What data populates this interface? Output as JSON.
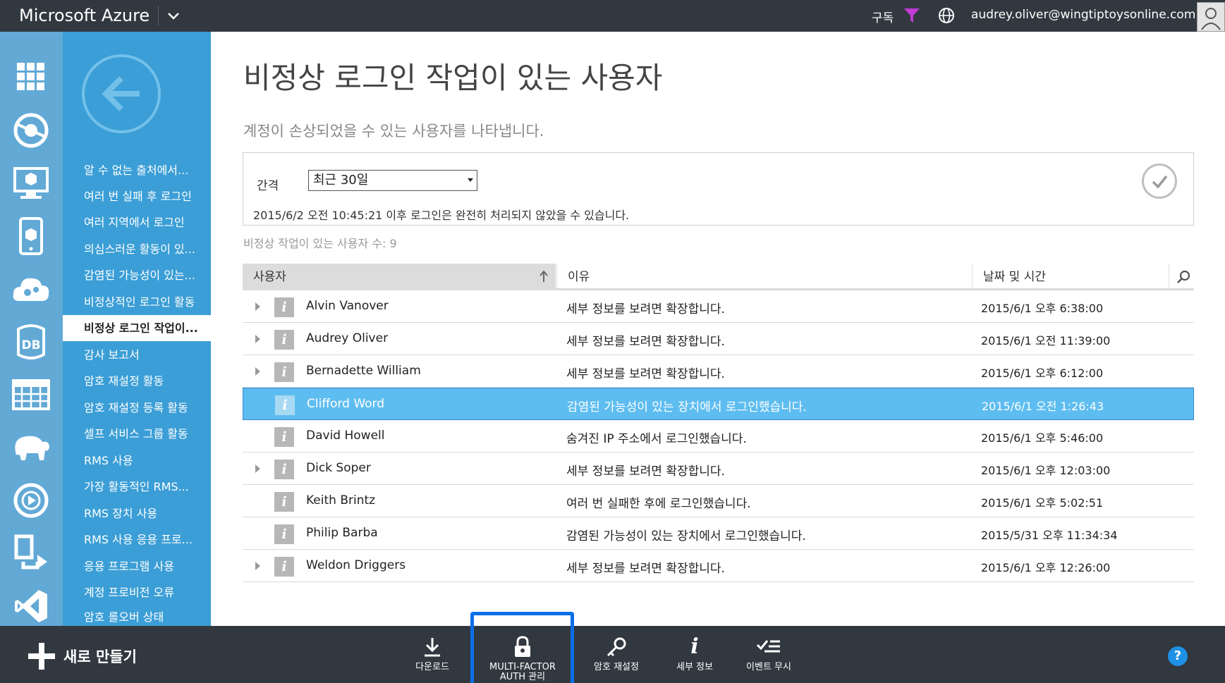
{
  "topbar": {
    "brand": "Microsoft Azure",
    "subscriptions_label": "구독",
    "user_email": "audrey.oliver@wingtiptoysonline.com"
  },
  "rail_icons": [
    "all-items-icon",
    "websites-icon",
    "virtual-machines-icon",
    "mobile-services-icon",
    "cloud-services-icon",
    "sql-databases-icon",
    "storage-icon",
    "hdinsight-icon",
    "media-services-icon",
    "service-bus-icon",
    "visual-studio-icon"
  ],
  "subnav": {
    "items": [
      "알 수 없는 출처에서...",
      "여러 번 실패 후 로그인",
      "여러 지역에서 로그인",
      "의심스러운 활동이 있...",
      "감염된 가능성이 있는...",
      "비정상적인 로그인 활동",
      "비정상 로그인 작업이...",
      "감사 보고서",
      "암호 재설정 활동",
      "암호 재설정 등록 활동",
      "셀프 서비스 그룹 활동",
      "RMS 사용",
      "가장 활동적인 RMS...",
      "RMS 장치 사용",
      "RMS 사용 응용 프로...",
      "응용 프로그램 사용",
      "계정 프로비전 오류",
      "암호 롤오버 상태"
    ],
    "active_index": 6
  },
  "main": {
    "title": "비정상 로그인 작업이 있는 사용자",
    "description": "계정이 손상되었을 수 있는 사용자를 나타냅니다.",
    "interval_label": "간격",
    "interval_value": "최근 30일",
    "processing_note": "2015/6/2 오전 10:45:21 이후 로그인은 완전히 처리되지 않았을 수 있습니다.",
    "count_text": "비정상 작업이 있는 사용자 수: 9"
  },
  "table": {
    "headers": {
      "user": "사용자",
      "reason": "이유",
      "date": "날짜 및 시간"
    },
    "rows": [
      {
        "user": "Alvin Vanover",
        "reason": "세부 정보를 보려면 확장합니다.",
        "date": "2015/6/1 오후 6:38:00",
        "expandable": true,
        "selected": false
      },
      {
        "user": "Audrey Oliver",
        "reason": "세부 정보를 보려면 확장합니다.",
        "date": "2015/6/1 오전 11:39:00",
        "expandable": true,
        "selected": false
      },
      {
        "user": "Bernadette William",
        "reason": "세부 정보를 보려면 확장합니다.",
        "date": "2015/6/1 오후 6:12:00",
        "expandable": true,
        "selected": false
      },
      {
        "user": "Clifford Word",
        "reason": "감염된 가능성이 있는 장치에서 로그인했습니다.",
        "date": "2015/6/1 오전 1:26:43",
        "expandable": false,
        "selected": true
      },
      {
        "user": "David Howell",
        "reason": "숨겨진 IP 주소에서 로그인했습니다.",
        "date": "2015/6/1 오후 5:46:00",
        "expandable": false,
        "selected": false
      },
      {
        "user": "Dick Soper",
        "reason": "세부 정보를 보려면 확장합니다.",
        "date": "2015/6/1 오후 12:03:00",
        "expandable": true,
        "selected": false
      },
      {
        "user": "Keith Brintz",
        "reason": "여러 번 실패한 후에 로그인했습니다.",
        "date": "2015/6/1 오후 5:02:51",
        "expandable": false,
        "selected": false
      },
      {
        "user": "Philip Barba",
        "reason": "감염된 가능성이 있는 장치에서 로그인했습니다.",
        "date": "2015/5/31 오후 11:34:34",
        "expandable": false,
        "selected": false
      },
      {
        "user": "Weldon Driggers",
        "reason": "세부 정보를 보려면 확장합니다.",
        "date": "2015/6/1 오후 12:26:00",
        "expandable": true,
        "selected": false
      }
    ]
  },
  "bottombar": {
    "new_label": "새로 만들기",
    "commands": {
      "download": "다운로드",
      "mfa_line1": "MULTI-FACTOR",
      "mfa_line2": "AUTH 관리",
      "reset_password": "암호 재설정",
      "details": "세부 정보",
      "ignore_event": "이벤트 무시"
    },
    "help": "?"
  },
  "colors": {
    "topbar": "#32383f",
    "rail": "#62a9d6",
    "subnav": "#3b9ed6",
    "selected_row": "#5ebdf0",
    "highlight_box": "#0a6fe8"
  }
}
